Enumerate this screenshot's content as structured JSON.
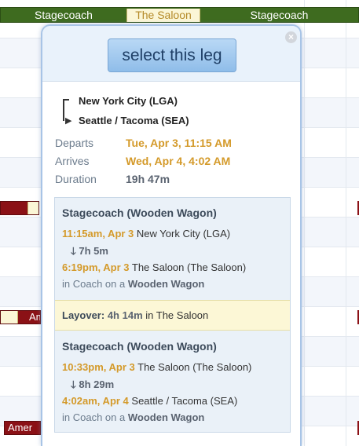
{
  "timeline": {
    "top_bar": {
      "left_label": "Stagecoach",
      "middle_label": "The Saloon",
      "right_label": "Stagecoach"
    },
    "flight_bar_1_label": "Am",
    "flight_bar_2_label": "Amer"
  },
  "popup": {
    "select_label": "select this leg",
    "close_icon": "×",
    "route": {
      "from": "New York City (LGA)",
      "to": "Seattle / Tacoma (SEA)"
    },
    "departs_label": "Departs",
    "departs_value": "Tue, Apr 3, 11:15 AM",
    "arrives_label": "Arrives",
    "arrives_value": "Wed, Apr 4, 4:02 AM",
    "duration_label": "Duration",
    "duration_value": "19h 47m",
    "legs": [
      {
        "title": "Stagecoach (Wooden Wagon)",
        "depart_time": "11:15am, Apr 3",
        "depart_place": "New York City (LGA)",
        "duration": "7h 5m",
        "arrive_time": "6:19pm, Apr 3",
        "arrive_place": "The Saloon (The Saloon)",
        "coach_prefix": "in Coach on a",
        "vehicle": "Wooden Wagon"
      },
      {
        "title": "Stagecoach (Wooden Wagon)",
        "depart_time": "10:33pm, Apr 3",
        "depart_place": "The Saloon (The Saloon)",
        "duration": "8h 29m",
        "arrive_time": "4:02am, Apr 4",
        "arrive_place": "Seattle / Tacoma (SEA)",
        "coach_prefix": "in Coach on a",
        "vehicle": "Wooden Wagon"
      }
    ],
    "layover": {
      "label": "Layover:",
      "duration": "4h 14m",
      "place": "in The Saloon"
    }
  }
}
